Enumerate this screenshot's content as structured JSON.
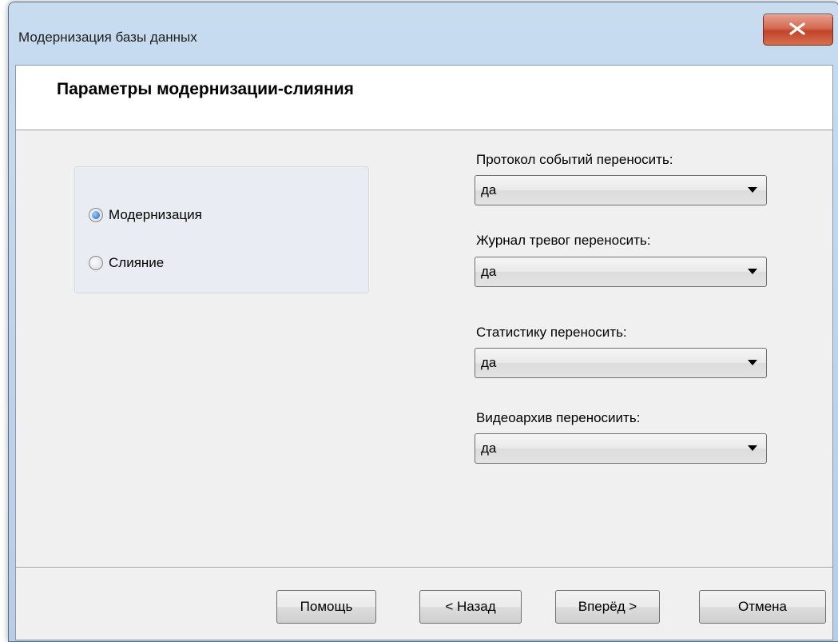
{
  "window": {
    "title": "Модернизация базы данных"
  },
  "header": {
    "title": "Параметры модернизации-слияния"
  },
  "mode": {
    "options": [
      {
        "label": "Модернизация",
        "checked": true
      },
      {
        "label": "Слияние",
        "checked": false
      }
    ]
  },
  "fields": [
    {
      "label": "Протокол событий переносить:",
      "value": "да"
    },
    {
      "label": "Журнал тревог переносить:",
      "value": "да"
    },
    {
      "label": "Статистику переносить:",
      "value": "да"
    },
    {
      "label": "Видеоархив переносиить:",
      "value": "да"
    }
  ],
  "buttons": {
    "help": "Помощь",
    "back": "< Назад",
    "next": "Вперёд >",
    "cancel": "Отмена"
  },
  "colors": {
    "close_button": "#c1442a",
    "radio_checked": "#1d5fbf"
  }
}
